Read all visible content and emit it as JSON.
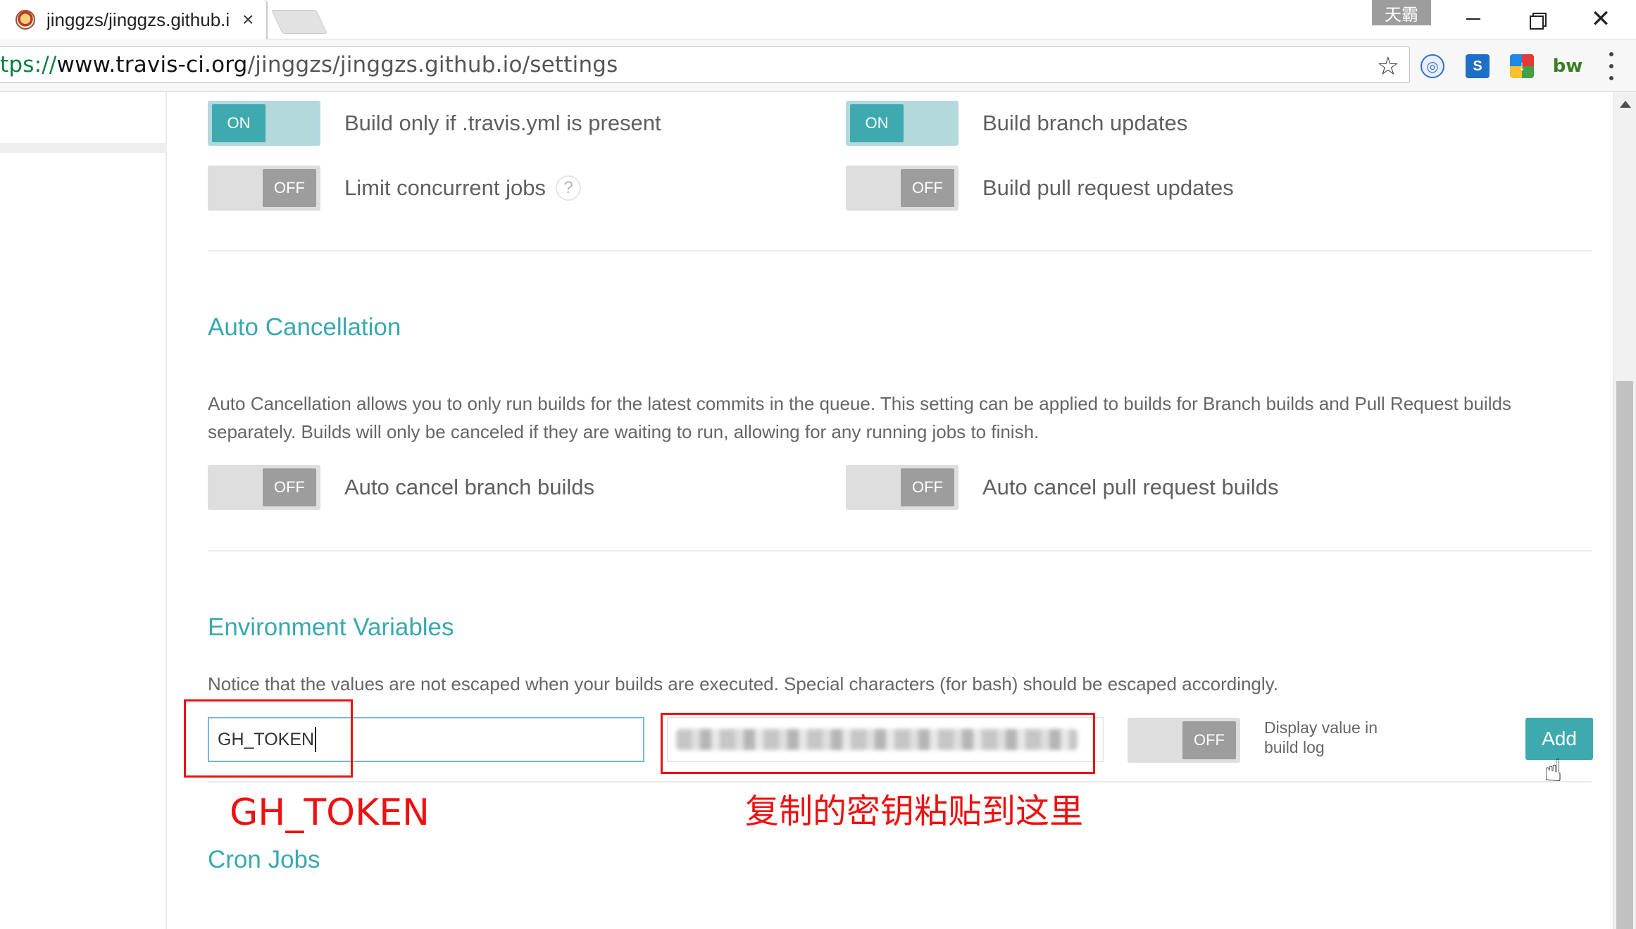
{
  "browser": {
    "tab_title": "jinggzs/jinggzs.github.i",
    "tab_close": "×",
    "ime_badge": "天霸",
    "close_glyph": "✕",
    "url_scheme": "tps://",
    "url_domain": "www.travis-ci.org",
    "url_path": "/jinggzs/jinggzs.github.io/settings",
    "star_glyph": "☆",
    "extensions": [
      "globe-extension-icon",
      "s-extension-icon",
      "download-extension-icon",
      "bw-extension-icon"
    ],
    "ext_bw_label": "bw"
  },
  "general": {
    "row1_left": {
      "state": "ON",
      "label": "Build only if .travis.yml is present"
    },
    "row1_right": {
      "state": "ON",
      "label": "Build branch updates"
    },
    "row2_left": {
      "state": "OFF",
      "label": "Limit concurrent jobs",
      "help": "?"
    },
    "row2_right": {
      "state": "OFF",
      "label": "Build pull request updates"
    }
  },
  "auto_cancellation": {
    "title": "Auto Cancellation",
    "description": "Auto Cancellation allows you to only run builds for the latest commits in the queue. This setting can be applied to builds for Branch builds and Pull Request builds separately. Builds will only be canceled if they are waiting to run, allowing for any running jobs to finish.",
    "left": {
      "state": "OFF",
      "label": "Auto cancel branch builds"
    },
    "right": {
      "state": "OFF",
      "label": "Auto cancel pull request builds"
    }
  },
  "environment_variables": {
    "title": "Environment Variables",
    "notice": "Notice that the values are not escaped when your builds are executed. Special characters (for bash) should be escaped accordingly.",
    "name_value": "GH_TOKEN",
    "display_toggle_state": "OFF",
    "display_label": "Display value in build log",
    "add_label": "Add"
  },
  "cron_jobs": {
    "title": "Cron Jobs"
  },
  "annotations": {
    "name_hint": "GH_TOKEN",
    "value_hint": "复制的密钥粘贴到这里"
  },
  "colors": {
    "accent": "#3eaaaf",
    "toggle_on_track": "#b3d9dd",
    "toggle_off_knob": "#9d9d9d",
    "annotation_red": "#ee1111"
  }
}
